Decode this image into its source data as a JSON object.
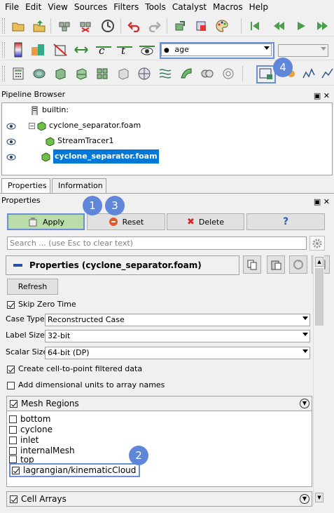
{
  "menu": [
    "File",
    "Edit",
    "View",
    "Sources",
    "Filters",
    "Tools",
    "Catalyst",
    "Macros",
    "Help"
  ],
  "toolbar2": {
    "array_select": "age"
  },
  "pipeline_browser": {
    "title": "Pipeline Browser",
    "items": [
      "builtin:",
      "cyclone_separator.foam",
      "StreamTracer1",
      "cyclone_separator.foam"
    ]
  },
  "tabs": [
    "Properties",
    "Information"
  ],
  "properties": {
    "title": "Properties",
    "buttons": {
      "apply": "Apply",
      "reset": "Reset",
      "delete": "Delete",
      "help": "?"
    },
    "search_placeholder": "Search ... (use Esc to clear text)",
    "section_title": "Properties (cyclone_separator.foam)",
    "refresh": "Refresh",
    "skip_zero_time": "Skip Zero Time",
    "case_type_label": "Case Type",
    "case_type_value": "Reconstructed Case",
    "label_size_label": "Label Size",
    "label_size_value": "32-bit",
    "scalar_size_label": "Scalar Size",
    "scalar_size_value": "64-bit (DP)",
    "create_cell_to_point": "Create cell-to-point filtered data",
    "add_dim_units": "Add dimensional units to array names",
    "mesh_regions_label": "Mesh Regions",
    "mesh_regions": [
      {
        "name": "bottom",
        "checked": false
      },
      {
        "name": "cyclone",
        "checked": false
      },
      {
        "name": "inlet",
        "checked": false
      },
      {
        "name": "internalMesh",
        "checked": false
      },
      {
        "name": "top",
        "checked": false
      },
      {
        "name": "lagrangian/kinematicCloud",
        "checked": true
      }
    ],
    "cell_arrays_label": "Cell Arrays"
  },
  "badges": [
    "1",
    "2",
    "3",
    "4"
  ],
  "colors": {
    "accent": "#5f86d9",
    "apply_bg": "#b9dca8",
    "selection": "#0078d7"
  }
}
